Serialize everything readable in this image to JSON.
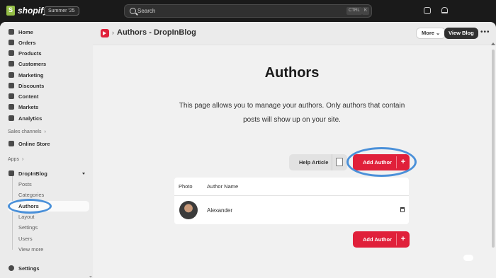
{
  "topbar": {
    "brand": "shopify",
    "edition": "Summer '25",
    "search_placeholder": "Search",
    "shortcut_ctrl": "CTRL",
    "shortcut_key": "K"
  },
  "sidebar": {
    "main_items": [
      {
        "label": "Home",
        "icon": "home-icon"
      },
      {
        "label": "Orders",
        "icon": "orders-icon"
      },
      {
        "label": "Products",
        "icon": "products-icon"
      },
      {
        "label": "Customers",
        "icon": "customers-icon"
      },
      {
        "label": "Marketing",
        "icon": "marketing-icon"
      },
      {
        "label": "Discounts",
        "icon": "discounts-icon"
      },
      {
        "label": "Content",
        "icon": "content-icon"
      },
      {
        "label": "Markets",
        "icon": "markets-icon"
      },
      {
        "label": "Analytics",
        "icon": "analytics-icon"
      }
    ],
    "sales_channels_label": "Sales channels",
    "online_store": "Online Store",
    "apps_label": "Apps",
    "app_name": "DropInBlog",
    "app_sub_items": [
      "Posts",
      "Categories",
      "Authors",
      "Layout",
      "Settings",
      "Users",
      "View more"
    ],
    "active_sub_item": "Authors",
    "settings": "Settings"
  },
  "header": {
    "title": "Authors - DropInBlog",
    "more_label": "More",
    "view_blog_label": "View Blog",
    "dots": "•••"
  },
  "main": {
    "heading": "Authors",
    "description_line1": "This page allows you to manage your authors. Only authors that contain",
    "description_line2": "posts will show up on your site.",
    "help_article_label": "Help Article",
    "add_author_label": "Add Author",
    "plus": "+",
    "table": {
      "columns": [
        "Photo",
        "Author Name"
      ],
      "rows": [
        {
          "name": "Alexander"
        }
      ]
    }
  },
  "colors": {
    "brand_red": "#e0203a",
    "highlight_blue": "#4a90d9",
    "topbar_bg": "#1a1a1a"
  }
}
